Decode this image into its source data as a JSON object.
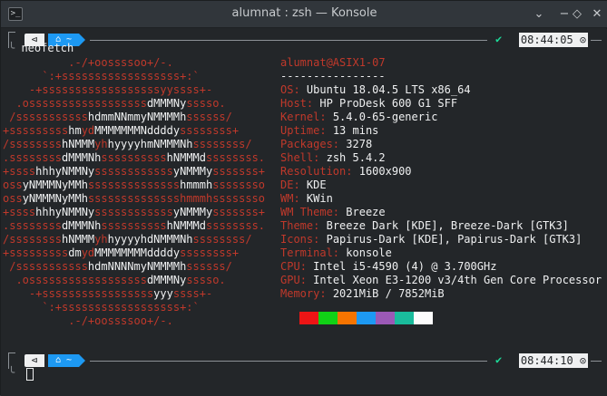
{
  "window": {
    "title": "alumnat : zsh — Konsole",
    "app_icon": ">_",
    "controls": {
      "menu": "⌄",
      "minimize": "−",
      "maximize": "◇",
      "close": "✕"
    }
  },
  "prompt_top": {
    "icon": "⊲",
    "home": "⌂ ~",
    "check": "✔",
    "time": "08:44:05 ⊙"
  },
  "command": "neofetch",
  "logo": [
    {
      "segs": [
        [
          "r",
          "          .-/+oossssoo+/-."
        ]
      ]
    },
    {
      "segs": [
        [
          "r",
          "      `:+ssssssssssssssssss+:`"
        ]
      ]
    },
    {
      "segs": [
        [
          "r",
          "    -+ssssssssssssssssssyyssss+-"
        ]
      ]
    },
    {
      "segs": [
        [
          "r",
          "  .ossssssssssssssssss"
        ],
        [
          "w",
          "dMMMNy"
        ],
        [
          "r",
          "sssso."
        ]
      ]
    },
    {
      "segs": [
        [
          "r",
          " /sssssssssss"
        ],
        [
          "w",
          "hdmmNNmmyNMMMMh"
        ],
        [
          "r",
          "ssssss/"
        ]
      ]
    },
    {
      "segs": [
        [
          "r",
          "+sssssssss"
        ],
        [
          "w",
          "hm"
        ],
        [
          "r",
          "yd"
        ],
        [
          "w",
          "MMMMMMMNddddy"
        ],
        [
          "r",
          "ssssssss+"
        ]
      ]
    },
    {
      "segs": [
        [
          "r",
          "/ssssssss"
        ],
        [
          "w",
          "hNMMM"
        ],
        [
          "r",
          "yh"
        ],
        [
          "w",
          "hyyyyhmNMMMNh"
        ],
        [
          "r",
          "ssssssss/"
        ]
      ]
    },
    {
      "segs": [
        [
          "r",
          ".ssssssss"
        ],
        [
          "w",
          "dMMMNh"
        ],
        [
          "r",
          "ssssssssss"
        ],
        [
          "w",
          "hNMMMd"
        ],
        [
          "r",
          "ssssssss."
        ]
      ]
    },
    {
      "segs": [
        [
          "r",
          "+ssss"
        ],
        [
          "w",
          "hhhyNMMNy"
        ],
        [
          "r",
          "ssssssssssss"
        ],
        [
          "w",
          "yNMMMy"
        ],
        [
          "r",
          "sssssss+"
        ]
      ]
    },
    {
      "segs": [
        [
          "r",
          "oss"
        ],
        [
          "w",
          "yNMMMNyMMh"
        ],
        [
          "r",
          "ssssssssssssss"
        ],
        [
          "w",
          "hmmmh"
        ],
        [
          "r",
          "ssssssso"
        ]
      ]
    },
    {
      "segs": [
        [
          "r",
          "oss"
        ],
        [
          "w",
          "yNMMMNyMMh"
        ],
        [
          "r",
          "sssssssssssssshmmmhssssssso"
        ]
      ]
    },
    {
      "segs": [
        [
          "r",
          "+ssss"
        ],
        [
          "w",
          "hhhyNMMNy"
        ],
        [
          "r",
          "ssssssssssss"
        ],
        [
          "w",
          "yNMMMy"
        ],
        [
          "r",
          "sssssss+"
        ]
      ]
    },
    {
      "segs": [
        [
          "r",
          ".ssssssss"
        ],
        [
          "w",
          "dMMMNh"
        ],
        [
          "r",
          "ssssssssss"
        ],
        [
          "w",
          "hNMMMd"
        ],
        [
          "r",
          "ssssssss."
        ]
      ]
    },
    {
      "segs": [
        [
          "r",
          "/ssssssss"
        ],
        [
          "w",
          "hNMMM"
        ],
        [
          "r",
          "yh"
        ],
        [
          "w",
          "hyyyyhdNMMMNh"
        ],
        [
          "r",
          "ssssssss/"
        ]
      ]
    },
    {
      "segs": [
        [
          "r",
          "+sssssssss"
        ],
        [
          "w",
          "dm"
        ],
        [
          "r",
          "yd"
        ],
        [
          "w",
          "MMMMMMMMddddy"
        ],
        [
          "r",
          "ssssssss+"
        ]
      ]
    },
    {
      "segs": [
        [
          "r",
          " /sssssssssss"
        ],
        [
          "w",
          "hdmNNNNmyNMMMMh"
        ],
        [
          "r",
          "ssssss/"
        ]
      ]
    },
    {
      "segs": [
        [
          "r",
          "  .ossssssssssssssssss"
        ],
        [
          "w",
          "dMMMNy"
        ],
        [
          "r",
          "sssso."
        ]
      ]
    },
    {
      "segs": [
        [
          "r",
          "    -+sssssssssssssssss"
        ],
        [
          "w",
          "yyy"
        ],
        [
          "r",
          "ssss+-"
        ]
      ]
    },
    {
      "segs": [
        [
          "r",
          "      `:+ssssssssssssssssss+:`"
        ]
      ]
    },
    {
      "segs": [
        [
          "r",
          "          .-/+oossssoo+/-."
        ]
      ]
    }
  ],
  "info": {
    "header": "alumnat@ASIX1-07",
    "separator": "----------------",
    "rows": [
      {
        "key": "OS",
        "value": "Ubuntu 18.04.5 LTS x86_64"
      },
      {
        "key": "Host",
        "value": "HP ProDesk 600 G1 SFF"
      },
      {
        "key": "Kernel",
        "value": "5.4.0-65-generic"
      },
      {
        "key": "Uptime",
        "value": "13 mins"
      },
      {
        "key": "Packages",
        "value": "3278"
      },
      {
        "key": "Shell",
        "value": "zsh 5.4.2"
      },
      {
        "key": "Resolution",
        "value": "1600x900"
      },
      {
        "key": "DE",
        "value": "KDE"
      },
      {
        "key": "WM",
        "value": "KWin"
      },
      {
        "key": "WM Theme",
        "value": "Breeze"
      },
      {
        "key": "Theme",
        "value": "Breeze Dark [KDE], Breeze-Dark [GTK3]"
      },
      {
        "key": "Icons",
        "value": "Papirus-Dark [KDE], Papirus-Dark [GTK3]"
      },
      {
        "key": "Terminal",
        "value": "konsole"
      },
      {
        "key": "CPU",
        "value": "Intel i5-4590 (4) @ 3.700GHz"
      },
      {
        "key": "GPU",
        "value": "Intel Xeon E3-1200 v3/4th Gen Core Processor"
      },
      {
        "key": "Memory",
        "value": "2021MiB / 7852MiB"
      }
    ]
  },
  "palette": [
    "#ed1515",
    "#11d116",
    "#f67400",
    "#1d99f3",
    "#9b59b6",
    "#1abc9c",
    "#fcfcfc"
  ],
  "prompt_bottom": {
    "icon": "⊲",
    "home": "⌂ ~",
    "check": "✔",
    "time": "08:44:10 ⊙"
  },
  "colors": {
    "background": "#232629",
    "accent_red": "#c0392b",
    "accent_blue": "#1d99f3",
    "text": "#eff0f1"
  }
}
